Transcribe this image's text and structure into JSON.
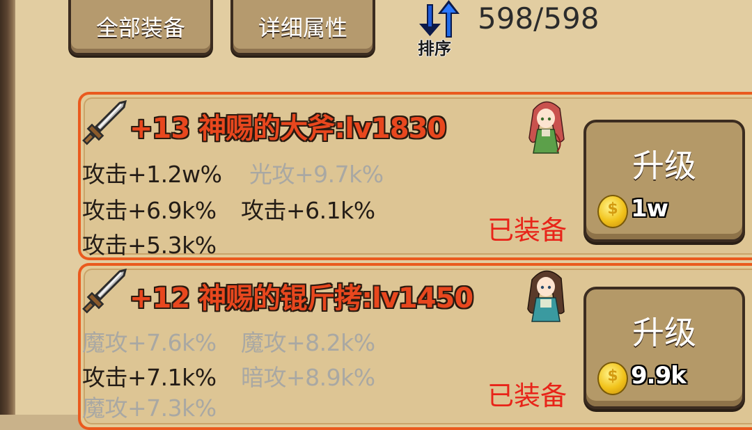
{
  "toolbar": {
    "all_equipment": "全部装备",
    "detail_attributes": "详细属性",
    "sort_label": "排序",
    "capacity": "598/598"
  },
  "items": [
    {
      "title": "+13 神赐的大斧:lv1830",
      "icon": "sword-icon",
      "avatar": "red-hair-girl",
      "stats": [
        {
          "text": "攻击+1.2w%",
          "active": true
        },
        {
          "text": "光攻+9.7k%",
          "active": false
        },
        {
          "text": "攻击+6.9k%",
          "active": true
        },
        {
          "text": "攻击+6.1k%",
          "active": true
        },
        {
          "text": "攻击+5.3k%",
          "active": true
        }
      ],
      "status": "已装备",
      "upgrade_label": "升级",
      "cost": "1w"
    },
    {
      "title": "+12 神赐的锟斤拷:lv1450",
      "icon": "sword-icon",
      "avatar": "brown-hair-elf",
      "stats": [
        {
          "text": "魔攻+7.6k%",
          "active": false
        },
        {
          "text": "魔攻+8.2k%",
          "active": false
        },
        {
          "text": "攻击+7.1k%",
          "active": true
        },
        {
          "text": "暗攻+8.9k%",
          "active": false
        },
        {
          "text": "魔攻+7.3k%",
          "active": false
        }
      ],
      "status": "已装备",
      "upgrade_label": "升级",
      "cost": "9.9k"
    }
  ],
  "colors": {
    "panel": "#e2cda1",
    "card_border": "#ea5a1e",
    "title": "#e8471e",
    "equipped": "#e82419",
    "dim_stat": "#a9a8a3"
  }
}
